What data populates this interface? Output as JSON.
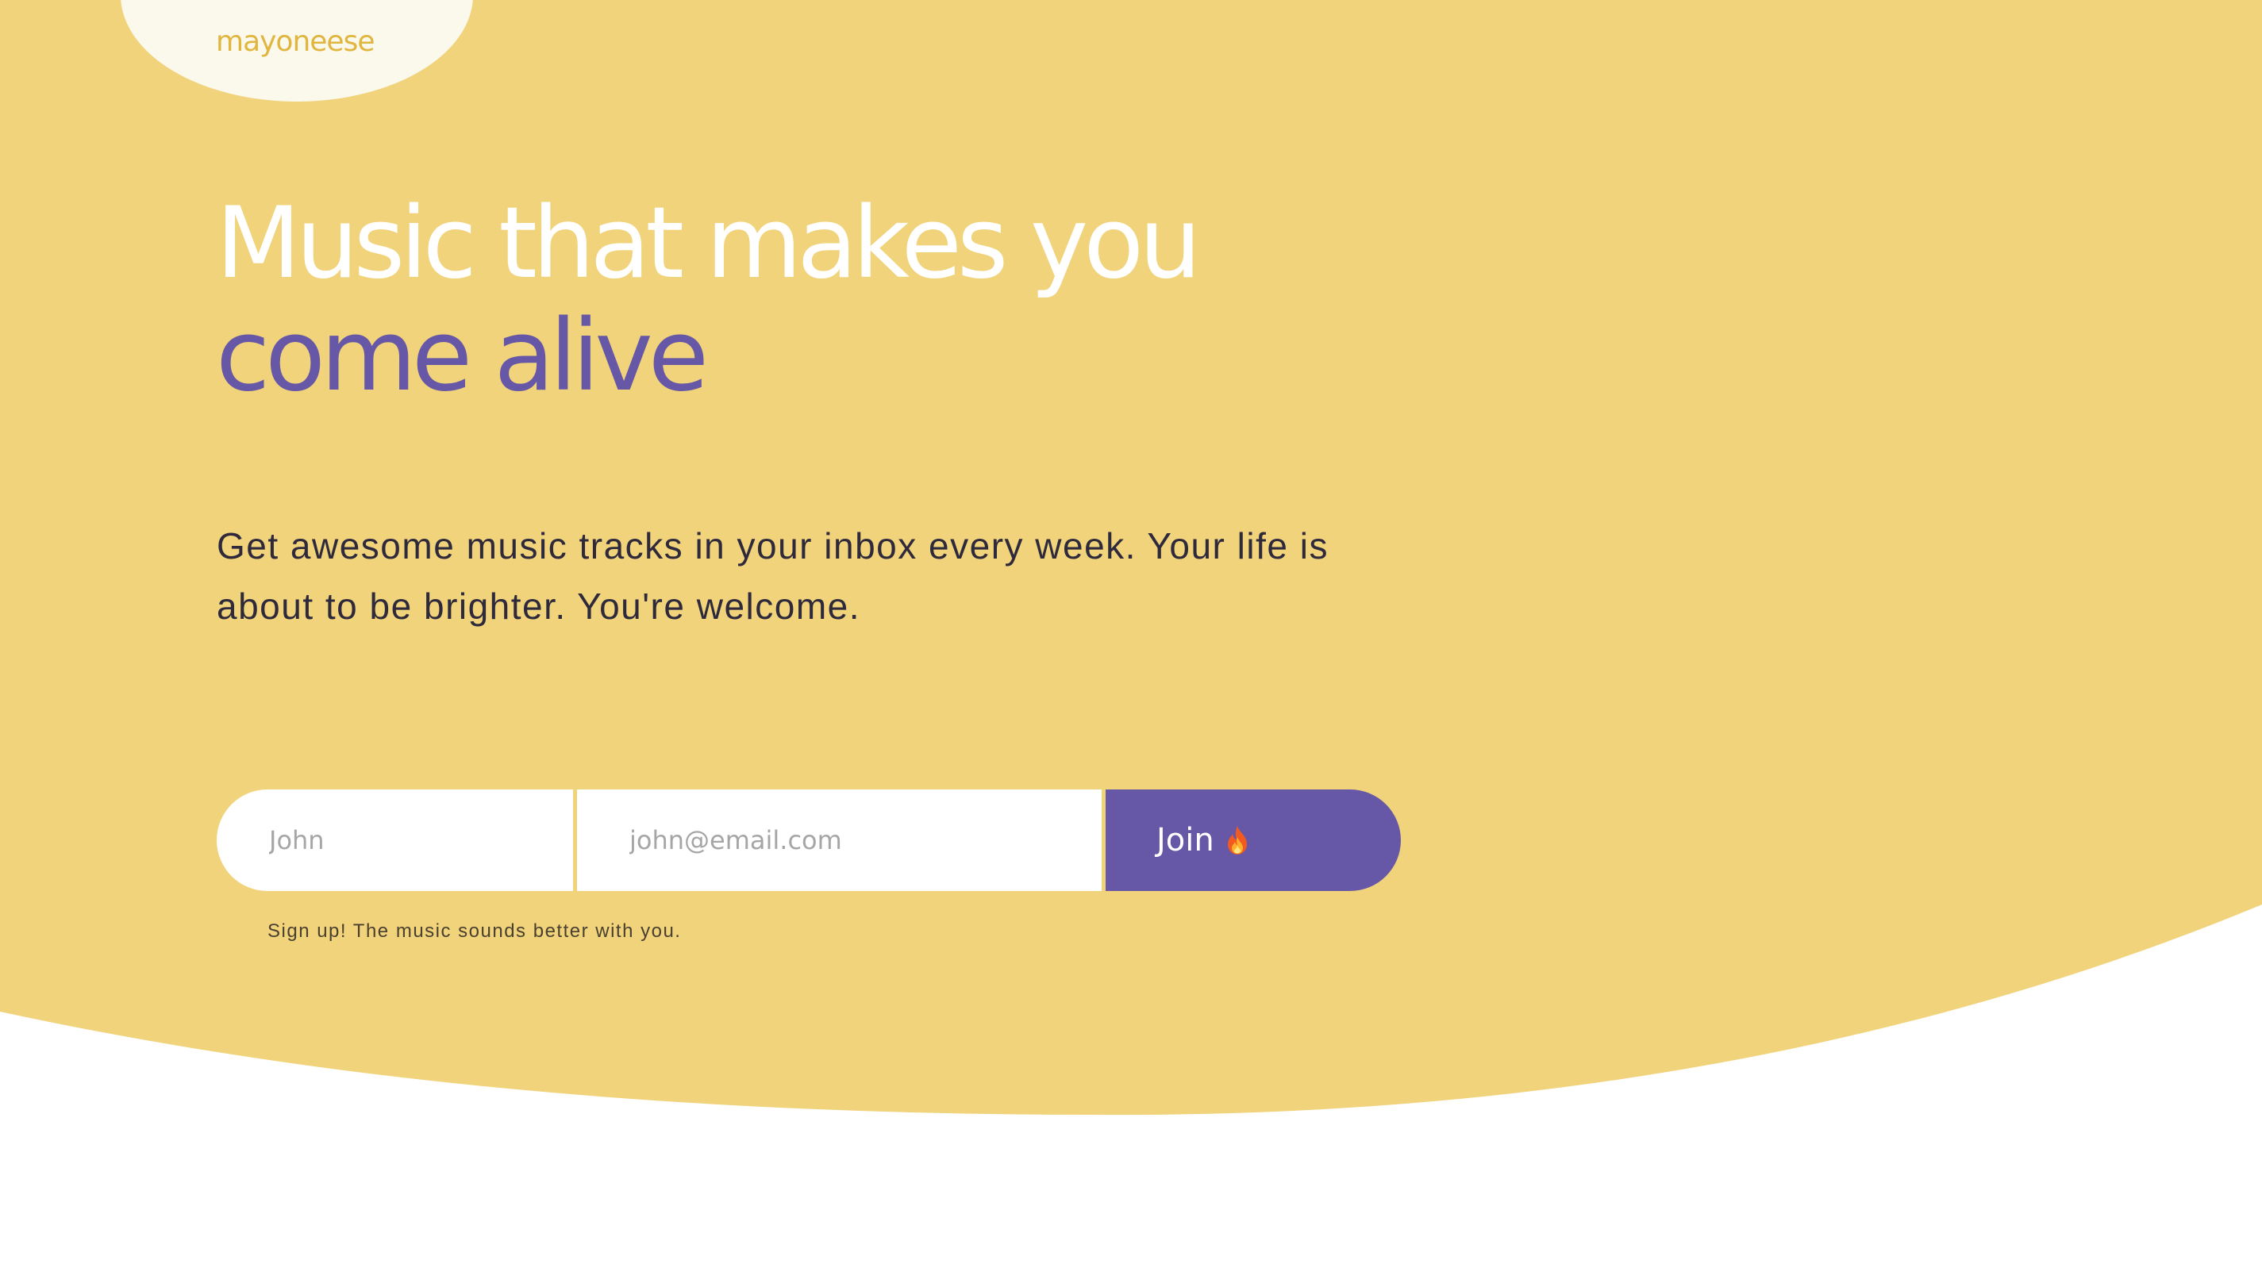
{
  "brand": {
    "logo_text": "mayoneese"
  },
  "hero": {
    "headline_line1": "Music that makes you",
    "headline_line2": "come alive",
    "description": "Get awesome music tracks in your inbox every week. Your life is about to be brighter. You're welcome."
  },
  "signup": {
    "name_placeholder": "John",
    "name_value": "",
    "email_placeholder": "john@email.com",
    "email_value": "",
    "join_label": "Join",
    "join_icon": "fire-icon",
    "helper_text": "Sign up! The music sounds better with you."
  },
  "colors": {
    "hero_background": "#f1d37b",
    "logo_blob": "#fbf8ec",
    "logo_text": "#e0b63f",
    "accent_purple": "#6658a6",
    "headline_white": "#ffffff",
    "body_text": "#2f2a3b"
  }
}
